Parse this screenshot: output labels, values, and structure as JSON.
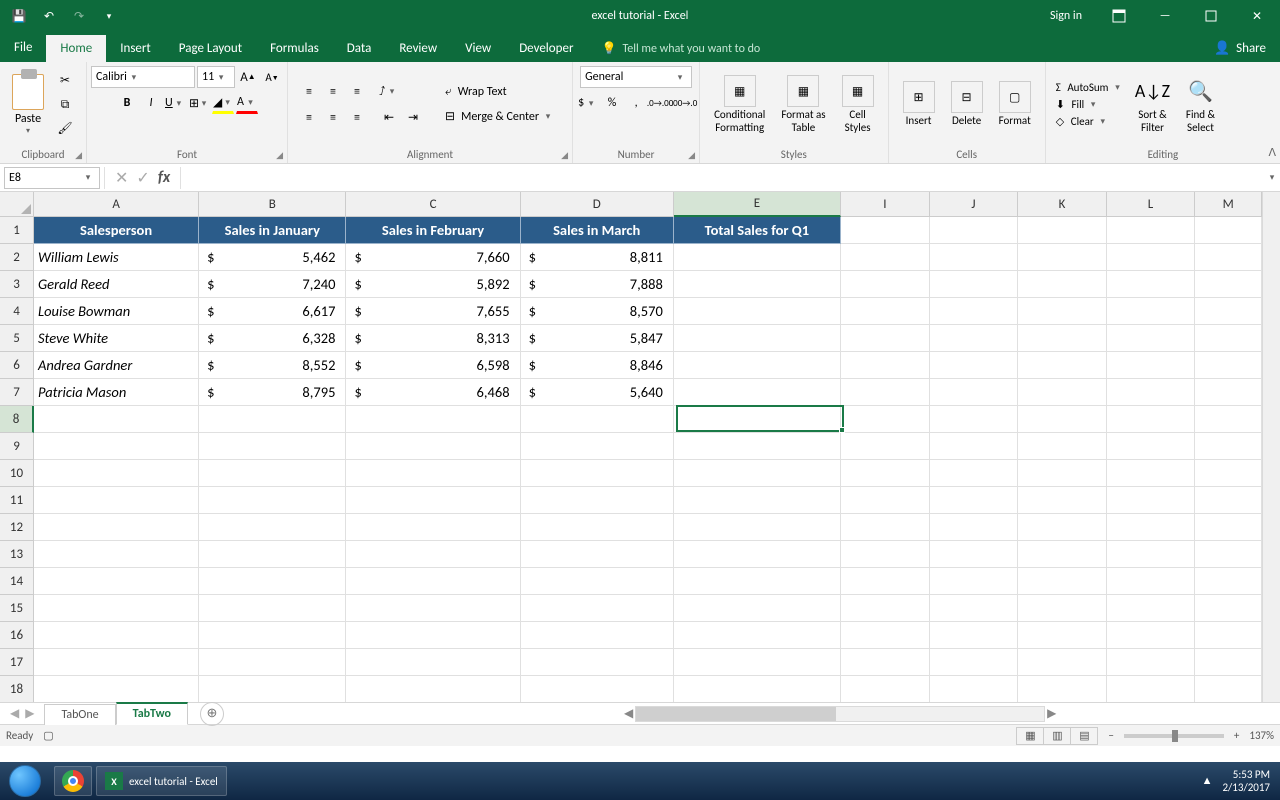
{
  "titlebar": {
    "title": "excel tutorial - Excel",
    "signin": "Sign in"
  },
  "ribbon_tabs": {
    "file": "File",
    "home": "Home",
    "insert": "Insert",
    "page_layout": "Page Layout",
    "formulas": "Formulas",
    "data": "Data",
    "review": "Review",
    "view": "View",
    "developer": "Developer",
    "tellme": "Tell me what you want to do",
    "share": "Share"
  },
  "ribbon": {
    "clipboard": {
      "label": "Clipboard",
      "paste": "Paste"
    },
    "font": {
      "label": "Font",
      "name": "Calibri",
      "size": "11"
    },
    "alignment": {
      "label": "Alignment",
      "wrap": "Wrap Text",
      "merge": "Merge & Center"
    },
    "number": {
      "label": "Number",
      "format": "General"
    },
    "styles": {
      "label": "Styles",
      "cond": "Conditional\nFormatting",
      "fat": "Format as\nTable",
      "cell": "Cell\nStyles"
    },
    "cells": {
      "label": "Cells",
      "insert": "Insert",
      "delete": "Delete",
      "format": "Format"
    },
    "editing": {
      "label": "Editing",
      "autosum": "AutoSum",
      "fill": "Fill",
      "clear": "Clear",
      "sort": "Sort &\nFilter",
      "find": "Find &\nSelect"
    }
  },
  "formula_bar": {
    "name_box": "E8",
    "formula": ""
  },
  "columns": [
    {
      "letter": "A",
      "width": 166
    },
    {
      "letter": "B",
      "width": 148
    },
    {
      "letter": "C",
      "width": 175
    },
    {
      "letter": "D",
      "width": 154
    },
    {
      "letter": "E",
      "width": 168
    },
    {
      "letter": "I",
      "width": 89
    },
    {
      "letter": "J",
      "width": 89
    },
    {
      "letter": "K",
      "width": 89
    },
    {
      "letter": "L",
      "width": 89
    },
    {
      "letter": "M",
      "width": 67
    }
  ],
  "row_count": 18,
  "headers": [
    "Salesperson",
    "Sales in January",
    "Sales in February",
    "Sales in March",
    "Total Sales for Q1"
  ],
  "rows": [
    {
      "name": "William Lewis",
      "jan": "5,462",
      "feb": "7,660",
      "mar": "8,811"
    },
    {
      "name": "Gerald Reed",
      "jan": "7,240",
      "feb": "5,892",
      "mar": "7,888"
    },
    {
      "name": "Louise Bowman",
      "jan": "6,617",
      "feb": "7,655",
      "mar": "8,570"
    },
    {
      "name": "Steve White",
      "jan": "6,328",
      "feb": "8,313",
      "mar": "5,847"
    },
    {
      "name": "Andrea Gardner",
      "jan": "8,552",
      "feb": "6,598",
      "mar": "8,846"
    },
    {
      "name": "Patricia Mason",
      "jan": "8,795",
      "feb": "6,468",
      "mar": "5,640"
    }
  ],
  "active_cell": {
    "col_index": 4,
    "row_index": 7
  },
  "sheets": {
    "tabs": [
      "TabOne",
      "TabTwo"
    ],
    "active": 1
  },
  "statusbar": {
    "ready": "Ready",
    "zoom": "137%"
  },
  "taskbar": {
    "app": "excel tutorial - Excel",
    "time": "5:53 PM",
    "date": "2/13/2017"
  }
}
